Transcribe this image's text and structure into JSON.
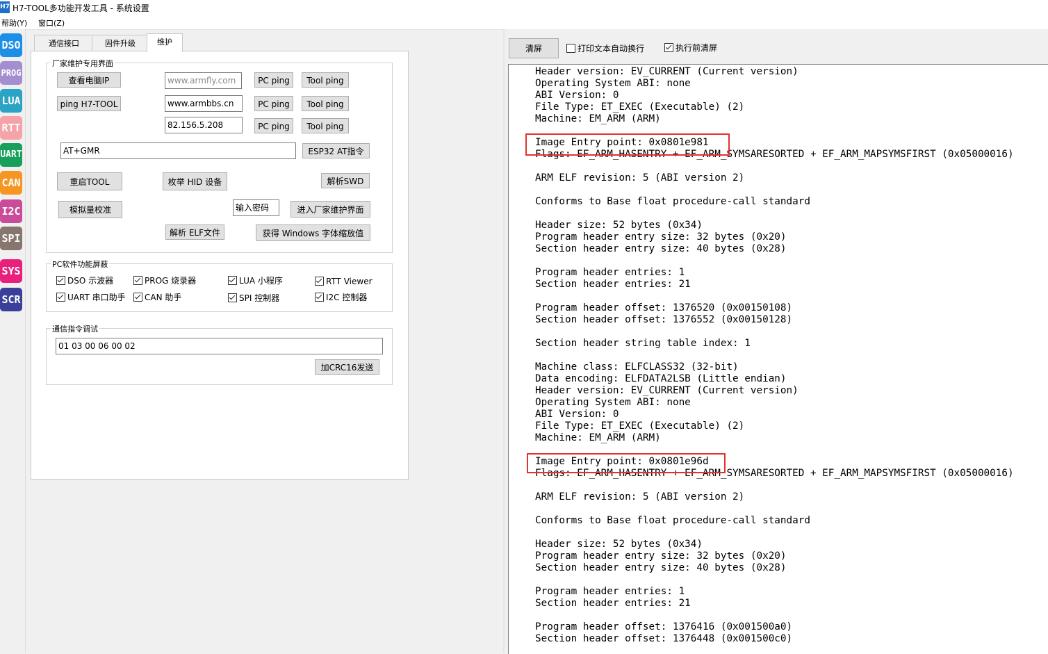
{
  "window": {
    "icon": "H7",
    "title": "H7-TOOL多功能开发工具 - 系统设置"
  },
  "menu": {
    "help": "帮助(Y)",
    "window": "窗口(Z)"
  },
  "sidebar": {
    "items": [
      {
        "label": "DSO",
        "color": "#1e8fe6"
      },
      {
        "label": "PROG",
        "color": "#a38fd0"
      },
      {
        "label": "LUA",
        "color": "#2aa3c5"
      },
      {
        "label": "RTT",
        "color": "#f5a3a8"
      },
      {
        "label": "UART",
        "color": "#16a05a"
      },
      {
        "label": "CAN",
        "color": "#f59623"
      },
      {
        "label": "I2C",
        "color": "#c94b9a"
      },
      {
        "label": "SPI",
        "color": "#86766e"
      },
      {
        "label": "SYS",
        "color": "#e8207c"
      },
      {
        "label": "SCR",
        "color": "#3a3f9a"
      }
    ]
  },
  "tabs": [
    {
      "label": "通信接口"
    },
    {
      "label": "固件升级"
    },
    {
      "label": "维护"
    }
  ],
  "factory": {
    "title": "厂家维护专用界面",
    "view_ip": "查看电脑IP",
    "ping_tool": "ping H7-TOOL",
    "host1": "www.armfly.com",
    "host2": "www.armbbs.cn",
    "host3": "82.156.5.208",
    "pc_ping": "PC ping",
    "tool_ping": "Tool ping",
    "at_cmd": "AT+GMR",
    "esp32_btn": "ESP32 AT指令",
    "restart": "重启TOOL",
    "enum_hid": "枚举 HID 设备",
    "parse_swd": "解析SWD",
    "analog_cal": "模拟量校准",
    "password_placeholder": "输入密码",
    "enter_factory": "进入厂家维护界面",
    "parse_elf": "解析 ELF文件",
    "get_scale": "获得 Windows 字体缩放值"
  },
  "mask": {
    "title": "PC软件功能屏蔽",
    "items": [
      {
        "label": "DSO 示波器",
        "checked": true
      },
      {
        "label": "PROG 烧录器",
        "checked": true
      },
      {
        "label": "LUA 小程序",
        "checked": true
      },
      {
        "label": "RTT Viewer",
        "checked": true
      },
      {
        "label": "UART 串口助手",
        "checked": true
      },
      {
        "label": "CAN 助手",
        "checked": true
      },
      {
        "label": "SPI 控制器",
        "checked": true
      },
      {
        "label": "I2C 控制器",
        "checked": true
      }
    ]
  },
  "debug": {
    "title": "通信指令调试",
    "command": "01 03 00 06 00 02",
    "send_btn": "加CRC16发送"
  },
  "console_toolbar": {
    "clear": "清屏",
    "wrap_label": "打印文本自动换行",
    "wrap_checked": false,
    "clear_before_label": "执行前清屏",
    "clear_before_checked": true
  },
  "console": {
    "lines": [
      "Header version: EV_CURRENT (Current version)",
      "Operating System ABI: none",
      "ABI Version: 0",
      "File Type: ET_EXEC (Executable) (2)",
      "Machine: EM_ARM (ARM)",
      "",
      "Image Entry point: 0x0801e981",
      "Flags: EF_ARM_HASENTRY + EF_ARM_SYMSARESORTED + EF_ARM_MAPSYMSFIRST (0x05000016)",
      "",
      "ARM ELF revision: 5 (ABI version 2)",
      "",
      "Conforms to Base float procedure-call standard",
      "",
      "Header size: 52 bytes (0x34)",
      "Program header entry size: 32 bytes (0x20)",
      "Section header entry size: 40 bytes (0x28)",
      "",
      "Program header entries: 1",
      "Section header entries: 21",
      "",
      "Program header offset: 1376520 (0x00150108)",
      "Section header offset: 1376552 (0x00150128)",
      "",
      "Section header string table index: 1",
      "",
      "Machine class: ELFCLASS32 (32-bit)",
      "Data encoding: ELFDATA2LSB (Little endian)",
      "Header version: EV_CURRENT (Current version)",
      "Operating System ABI: none",
      "ABI Version: 0",
      "File Type: ET_EXEC (Executable) (2)",
      "Machine: EM_ARM (ARM)",
      "",
      "Image Entry point: 0x0801e96d",
      "Flags: EF_ARM_HASENTRY + EF_ARM_SYMSARESORTED + EF_ARM_MAPSYMSFIRST (0x05000016)",
      "",
      "ARM ELF revision: 5 (ABI version 2)",
      "",
      "Conforms to Base float procedure-call standard",
      "",
      "Header size: 52 bytes (0x34)",
      "Program header entry size: 32 bytes (0x20)",
      "Section header entry size: 40 bytes (0x28)",
      "",
      "Program header entries: 1",
      "Section header entries: 21",
      "",
      "Program header offset: 1376416 (0x001500a0)",
      "Section header offset: 1376448 (0x001500c0)"
    ]
  }
}
